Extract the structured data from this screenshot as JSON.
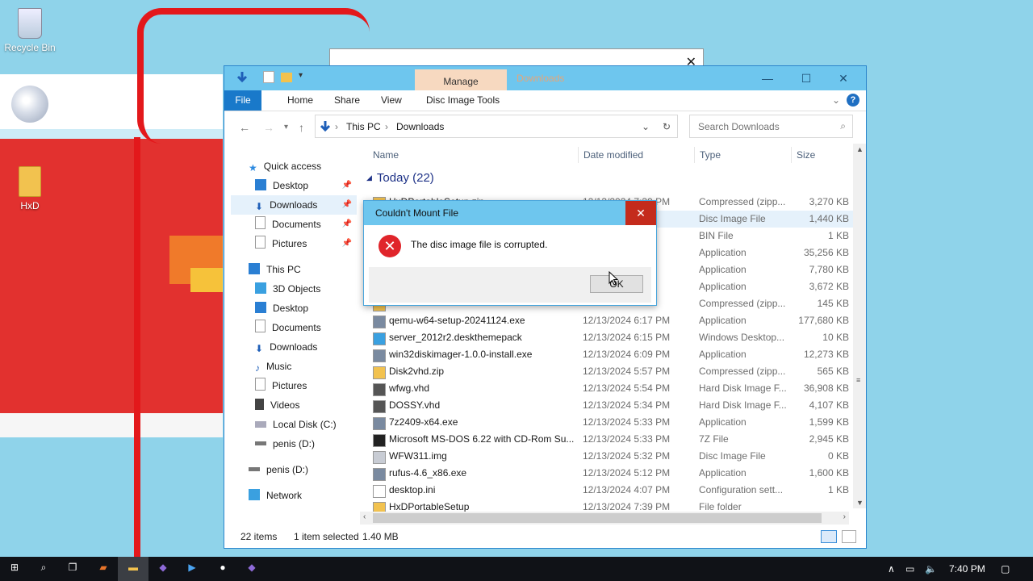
{
  "desktop": {
    "icons": [
      {
        "label": "Recycle Bin"
      },
      {
        "label": "HxD"
      }
    ]
  },
  "window": {
    "manage_tab": "Manage",
    "title": "Downloads",
    "minimize": "—",
    "maximize": "☐",
    "close": "✕",
    "ribbon_tabs": [
      "File",
      "Home",
      "Share",
      "View",
      "Disc Image Tools"
    ],
    "help": "?",
    "address": {
      "segments": [
        "This PC",
        "Downloads"
      ]
    },
    "search": {
      "placeholder": "Search Downloads"
    },
    "nav": {
      "quick_access": "Quick access",
      "quick_items": [
        "Desktop",
        "Downloads",
        "Documents",
        "Pictures"
      ],
      "this_pc": "This PC",
      "pc_items": [
        "3D Objects",
        "Desktop",
        "Documents",
        "Downloads",
        "Music",
        "Pictures",
        "Videos",
        "Local Disk (C:)",
        "penis (D:)"
      ],
      "drive": "penis (D:)",
      "network": "Network"
    },
    "columns": [
      "Name",
      "Date modified",
      "Type",
      "Size"
    ],
    "group": "Today (22)",
    "files": [
      {
        "name": "HxDPortableSetup.zip",
        "date": "12/13/2024 7:39 PM",
        "type": "Compressed (zipp...",
        "size": "3,270 KB"
      },
      {
        "name": "",
        "date": "",
        "type": "Disc Image File",
        "size": "1,440 KB"
      },
      {
        "name": "",
        "date": "",
        "type": "BIN File",
        "size": "1 KB"
      },
      {
        "name": "",
        "date": "",
        "type": "Application",
        "size": "35,256 KB"
      },
      {
        "name": "",
        "date": "",
        "type": "Application",
        "size": "7,780 KB"
      },
      {
        "name": "",
        "date": "",
        "type": "Application",
        "size": "3,672 KB"
      },
      {
        "name": "",
        "date": "",
        "type": "Compressed (zipp...",
        "size": "145 KB"
      },
      {
        "name": "qemu-w64-setup-20241124.exe",
        "date": "12/13/2024 6:17 PM",
        "type": "Application",
        "size": "177,680 KB"
      },
      {
        "name": "server_2012r2.deskthemepack",
        "date": "12/13/2024 6:15 PM",
        "type": "Windows Desktop...",
        "size": "10 KB"
      },
      {
        "name": "win32diskimager-1.0.0-install.exe",
        "date": "12/13/2024 6:09 PM",
        "type": "Application",
        "size": "12,273 KB"
      },
      {
        "name": "Disk2vhd.zip",
        "date": "12/13/2024 5:57 PM",
        "type": "Compressed (zipp...",
        "size": "565 KB"
      },
      {
        "name": "wfwg.vhd",
        "date": "12/13/2024 5:54 PM",
        "type": "Hard Disk Image F...",
        "size": "36,908 KB"
      },
      {
        "name": "DOSSY.vhd",
        "date": "12/13/2024 5:34 PM",
        "type": "Hard Disk Image F...",
        "size": "4,107 KB"
      },
      {
        "name": "7z2409-x64.exe",
        "date": "12/13/2024 5:33 PM",
        "type": "Application",
        "size": "1,599 KB"
      },
      {
        "name": "Microsoft MS-DOS 6.22 with CD-Rom Su...",
        "date": "12/13/2024 5:33 PM",
        "type": "7Z File",
        "size": "2,945 KB"
      },
      {
        "name": "WFW311.img",
        "date": "12/13/2024 5:32 PM",
        "type": "Disc Image File",
        "size": "0 KB"
      },
      {
        "name": "rufus-4.6_x86.exe",
        "date": "12/13/2024 5:12 PM",
        "type": "Application",
        "size": "1,600 KB"
      },
      {
        "name": "desktop.ini",
        "date": "12/13/2024 4:07 PM",
        "type": "Configuration sett...",
        "size": "1 KB"
      },
      {
        "name": "HxDPortableSetup",
        "date": "12/13/2024 7:39 PM",
        "type": "File folder",
        "size": ""
      }
    ],
    "status": {
      "count": "22 items",
      "selection": "1 item selected",
      "size": "1.40 MB"
    }
  },
  "dialog": {
    "title": "Couldn't Mount File",
    "message": "The disc image file is corrupted.",
    "ok": "OK",
    "close": "✕"
  },
  "colors": {
    "accent": "#1979ca",
    "titlebar": "#6ec6ee",
    "error": "#e0252b",
    "desktop_bg": "#8fd3ea"
  },
  "taskbar": {
    "time": "7:40 PM"
  }
}
